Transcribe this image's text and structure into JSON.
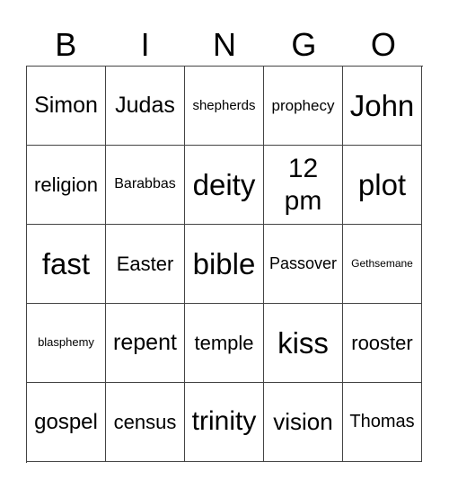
{
  "header": {
    "letters": [
      "B",
      "I",
      "N",
      "G",
      "O"
    ]
  },
  "board": {
    "rows": [
      [
        "Simon",
        "Judas",
        "shepherds",
        "prophecy",
        "John"
      ],
      [
        "religion",
        "Barabbas",
        "deity",
        "12 pm",
        "plot"
      ],
      [
        "fast",
        "Easter",
        "bible",
        "Passover",
        "Gethsemane"
      ],
      [
        "blasphemy",
        "repent",
        "temple",
        "kiss",
        "rooster"
      ],
      [
        "gospel",
        "census",
        "trinity",
        "vision",
        "Thomas"
      ]
    ]
  }
}
